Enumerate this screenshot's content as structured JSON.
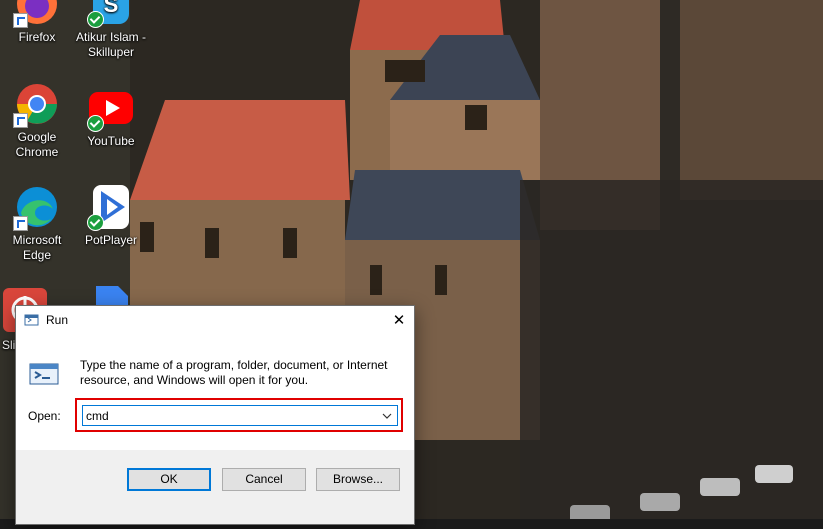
{
  "desktop": {
    "icons": [
      {
        "label": "Firefox",
        "name": "firefox"
      },
      {
        "label": "Atikur Islam - Skilluper",
        "name": "skilluper"
      },
      {
        "label": "Google Chrome",
        "name": "chrome"
      },
      {
        "label": "YouTube",
        "name": "youtube"
      },
      {
        "label": "Microsoft Edge",
        "name": "edge"
      },
      {
        "label": "PotPlayer",
        "name": "potplayer"
      },
      {
        "label": "Sli",
        "name": "partial-app"
      }
    ]
  },
  "run_dialog": {
    "title": "Run",
    "close_glyph": "✕",
    "description": "Type the name of a program, folder, document, or Internet resource, and Windows will open it for you.",
    "open_label": "Open:",
    "open_value": "cmd",
    "ok_label": "OK",
    "cancel_label": "Cancel",
    "browse_label": "Browse..."
  }
}
